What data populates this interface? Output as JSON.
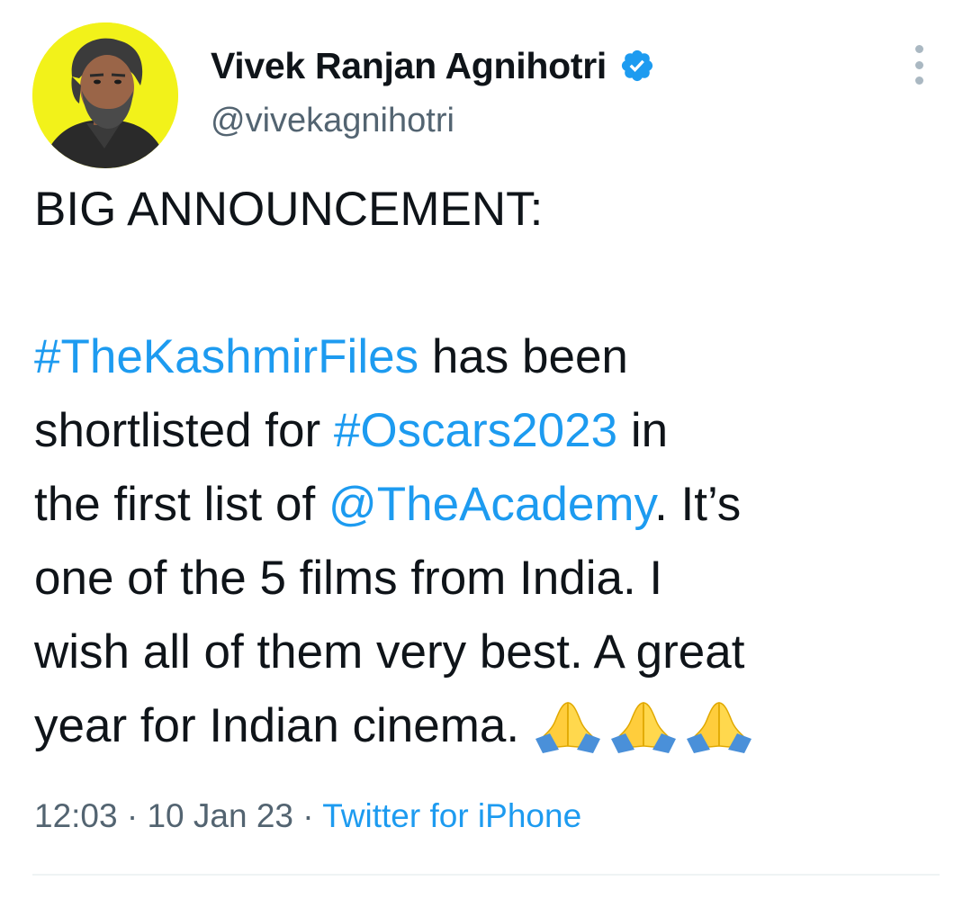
{
  "author": {
    "display_name": "Vivek Ranjan Agnihotri",
    "handle": "@vivekagnihotri",
    "verified_icon": "verified-badge-icon",
    "avatar_background": "#f2f21a"
  },
  "tweet": {
    "lines": [
      {
        "parts": [
          {
            "text": "BIG ANNOUNCEMENT:",
            "link": false
          }
        ]
      },
      {
        "parts": []
      },
      {
        "parts": [
          {
            "text": "#TheKashmirFiles",
            "link": true
          },
          {
            "text": " has been",
            "link": false
          }
        ]
      },
      {
        "parts": [
          {
            "text": "shortlisted for ",
            "link": false
          },
          {
            "text": "#Oscars2023",
            "link": true
          },
          {
            "text": " in",
            "link": false
          }
        ]
      },
      {
        "parts": [
          {
            "text": "the first list of ",
            "link": false
          },
          {
            "text": "@TheAcademy",
            "link": true
          },
          {
            "text": ". It’s",
            "link": false
          }
        ]
      },
      {
        "parts": [
          {
            "text": "one of the 5 films from India. I",
            "link": false
          }
        ]
      },
      {
        "parts": [
          {
            "text": "wish all of them very best. A great",
            "link": false
          }
        ]
      },
      {
        "parts": [
          {
            "text": "year for Indian cinema.",
            "link": false
          }
        ]
      }
    ],
    "emoji": [
      "folded-hands-icon",
      "folded-hands-icon",
      "folded-hands-icon"
    ]
  },
  "meta": {
    "time": "12:03",
    "separator": " · ",
    "date": "10 Jan 23",
    "source": "Twitter for iPhone"
  },
  "colors": {
    "link": "#1d9bf0",
    "secondary_text": "#536471",
    "primary_text": "#0f1419"
  }
}
